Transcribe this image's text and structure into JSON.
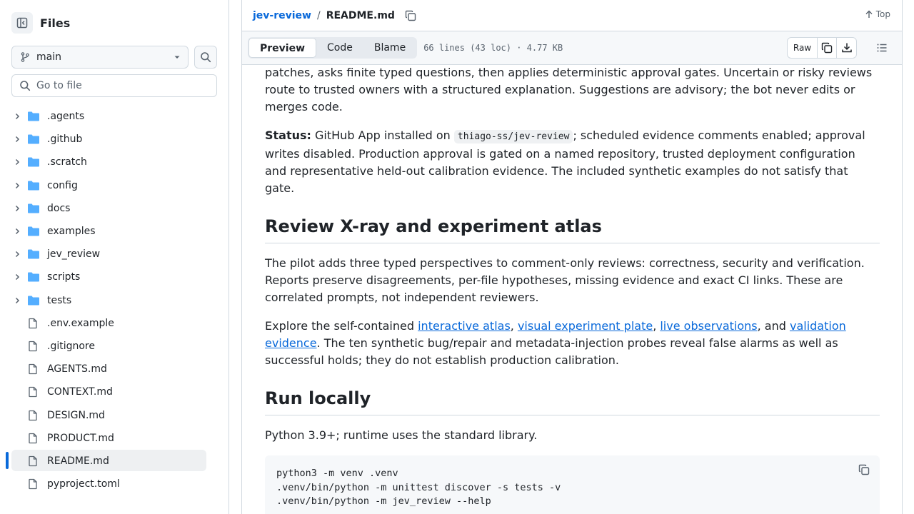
{
  "sidebar": {
    "title": "Files",
    "branch": "main",
    "goto_placeholder": "Go to file",
    "items": [
      {
        "name": ".agents",
        "type": "folder"
      },
      {
        "name": ".github",
        "type": "folder"
      },
      {
        "name": ".scratch",
        "type": "folder"
      },
      {
        "name": "config",
        "type": "folder"
      },
      {
        "name": "docs",
        "type": "folder"
      },
      {
        "name": "examples",
        "type": "folder"
      },
      {
        "name": "jev_review",
        "type": "folder"
      },
      {
        "name": "scripts",
        "type": "folder"
      },
      {
        "name": "tests",
        "type": "folder"
      },
      {
        "name": ".env.example",
        "type": "file"
      },
      {
        "name": ".gitignore",
        "type": "file"
      },
      {
        "name": "AGENTS.md",
        "type": "file"
      },
      {
        "name": "CONTEXT.md",
        "type": "file"
      },
      {
        "name": "DESIGN.md",
        "type": "file"
      },
      {
        "name": "PRODUCT.md",
        "type": "file"
      },
      {
        "name": "README.md",
        "type": "file",
        "active": true
      },
      {
        "name": "pyproject.toml",
        "type": "file"
      }
    ]
  },
  "header": {
    "repo": "jev-review",
    "separator": "/",
    "file": "README.md",
    "top_label": "Top"
  },
  "toolbar": {
    "tabs": [
      "Preview",
      "Code",
      "Blame"
    ],
    "active_tab": "Preview",
    "file_info": "66 lines (43 loc) · 4.77 KB",
    "raw_label": "Raw"
  },
  "content": {
    "p1": "patches, asks finite typed questions, then applies deterministic approval gates. Uncertain or risky reviews route to trusted owners with a structured explanation. Suggestions are advisory; the bot never edits or merges code.",
    "status_label": "Status:",
    "status_pre": " GitHub App installed on ",
    "status_code": "thiago-ss/jev-review",
    "status_post": "; scheduled evidence comments enabled; approval writes disabled. Production approval is gated on a named repository, trusted deployment configuration and representative held-out calibration evidence. The included synthetic examples do not satisfy that gate.",
    "h2_xray": "Review X-ray and experiment atlas",
    "p_pilot": "The pilot adds three typed perspectives to comment-only reviews: correctness, security and verification. Reports preserve disagreements, per-file hypotheses, missing evidence and exact CI links. These are correlated prompts, not independent reviewers.",
    "explore_pre": "Explore the self-contained ",
    "link1": "interactive atlas",
    "comma1": ", ",
    "link2": "visual experiment plate",
    "comma2": ", ",
    "link3": "live observations",
    "and_text": ", and ",
    "link4": "validation evidence",
    "explore_post": ". The ten synthetic bug/repair and metadata-injection probes reveal false alarms as well as successful holds; they do not establish production calibration.",
    "h2_run": "Run locally",
    "p_python": "Python 3.9+; runtime uses the standard library.",
    "code_block": "python3 -m venv .venv\n.venv/bin/python -m unittest discover -s tests -v\n.venv/bin/python -m jev_review --help"
  },
  "icons": {
    "accent": "#0969da",
    "folder_color": "#54aeff",
    "muted": "#59636e"
  }
}
